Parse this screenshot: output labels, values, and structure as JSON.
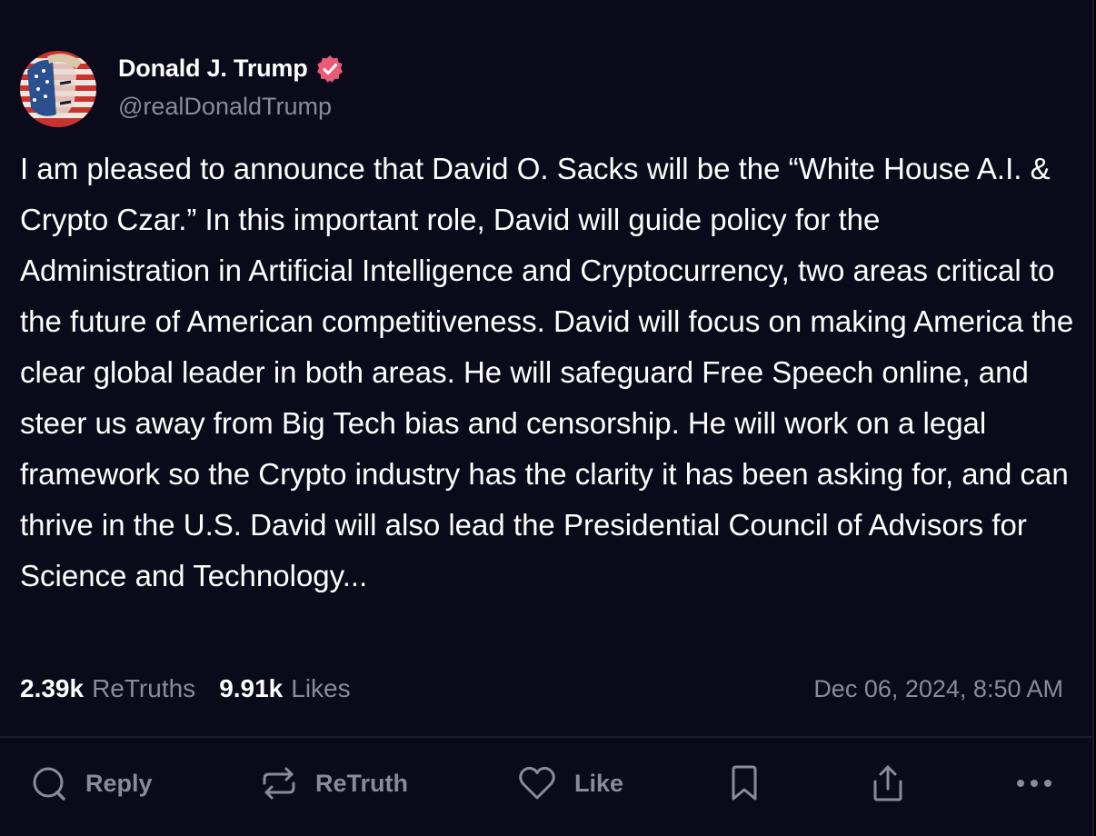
{
  "post": {
    "author": {
      "display_name": "Donald J. Trump",
      "handle": "@realDonaldTrump",
      "verified": true
    },
    "text": "I am pleased to announce that David O. Sacks will be the “White House A.I. & Crypto Czar.” In this important role, David will guide policy for the Administration in Artificial Intelligence and Cryptocurrency, two areas critical to the future of American competitiveness. David will focus on making America the clear global leader in both areas. He will safeguard Free Speech online, and steer us away from Big Tech bias and censorship. He will work on a legal framework so the Crypto industry has the clarity it has been asking for, and can thrive in the U.S. David will also lead the Presidential Council of Advisors for Science and Technology...",
    "stats": {
      "retruths_count": "2.39k",
      "retruths_label": "ReTruths",
      "likes_count": "9.91k",
      "likes_label": "Likes"
    },
    "timestamp": "Dec 06, 2024, 8:50 AM"
  },
  "actions": {
    "reply_label": "Reply",
    "retruth_label": "ReTruth",
    "like_label": "Like"
  },
  "icons": {
    "verified": "verified-badge-icon",
    "reply": "reply-bubble-icon",
    "retruth": "retruth-arrows-icon",
    "like": "heart-icon",
    "bookmark": "bookmark-icon",
    "share": "share-upload-icon",
    "more": "more-dots-icon"
  },
  "colors": {
    "background": "#0b0a1b",
    "text": "#ffffff",
    "muted": "#8a8a9a",
    "verified": "#ea5b78",
    "divider": "#1d1c2e"
  }
}
